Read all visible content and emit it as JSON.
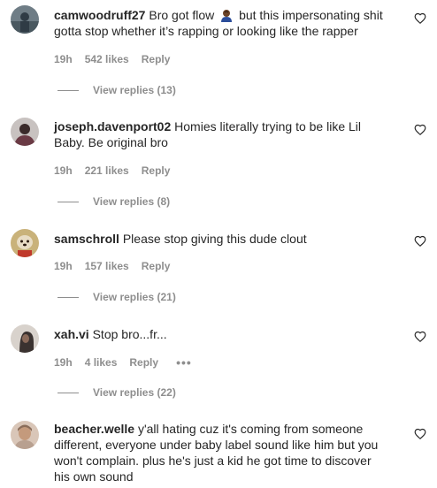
{
  "comments": [
    {
      "username": "camwoodruff27",
      "text_before_emoji": "Bro got flow",
      "emoji": "man-dark-skin-emoji",
      "text_after_emoji": "but this impersonating shit gotta stop whether it’s rapping or looking like the rapper",
      "time": "19h",
      "likes": "542 likes",
      "reply_label": "Reply",
      "view_replies": "View replies (13)",
      "avatar_colors": [
        "#6f7d86",
        "#2f3b45"
      ]
    },
    {
      "username": "joseph.davenport02",
      "text": "Homies literally trying to be like Lil Baby. Be original bro",
      "time": "19h",
      "likes": "221 likes",
      "reply_label": "Reply",
      "view_replies": "View replies (8)",
      "avatar_colors": [
        "#c8c2c0",
        "#6a3a44"
      ]
    },
    {
      "username": "samschroll",
      "text": "Please stop giving this dude clout",
      "time": "19h",
      "likes": "157 likes",
      "reply_label": "Reply",
      "view_replies": "View replies (21)",
      "avatar_colors": [
        "#c9b27a",
        "#7a5a3a"
      ]
    },
    {
      "username": "xah.vi",
      "text": "Stop bro...fr...",
      "time": "19h",
      "likes": "4 likes",
      "reply_label": "Reply",
      "more_label": "•••",
      "view_replies": "View replies (22)",
      "avatar_colors": [
        "#d8d2cc",
        "#3a3230"
      ]
    },
    {
      "username": "beacher.welle",
      "text": "y'all hating cuz it's coming from someone different, everyone under baby label sound like him but you won't complain. plus he's just a kid he got time to discover his own sound",
      "avatar_colors": [
        "#d9c6b8",
        "#8a6d5a"
      ]
    }
  ],
  "icons": {
    "like": "heart-outline-icon"
  }
}
